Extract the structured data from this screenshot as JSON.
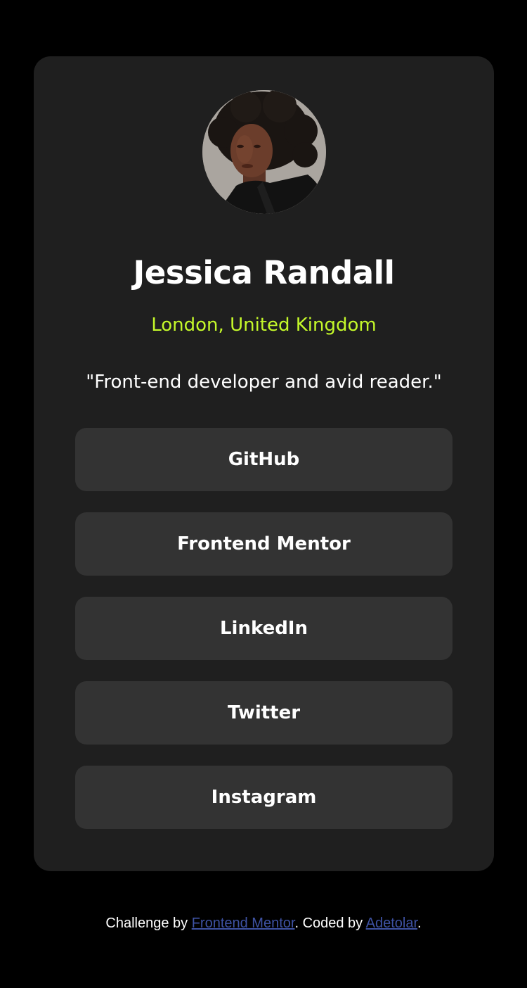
{
  "profile": {
    "name": "Jessica Randall",
    "location": "London, United Kingdom",
    "bio": "\"Front-end developer and avid reader.\""
  },
  "links": [
    {
      "label": "GitHub"
    },
    {
      "label": "Frontend Mentor"
    },
    {
      "label": "LinkedIn"
    },
    {
      "label": "Twitter"
    },
    {
      "label": "Instagram"
    }
  ],
  "footer": {
    "prefix": "Challenge by ",
    "challenge_link": "Frontend Mentor",
    "middle": ". Coded by ",
    "author_link": "Adetolar",
    "suffix": "."
  },
  "colors": {
    "page_background": "#000000",
    "card_background": "#1f1f1f",
    "button_background": "#333333",
    "accent_green": "#c4f82a",
    "footer_link": "#3e52a3"
  }
}
